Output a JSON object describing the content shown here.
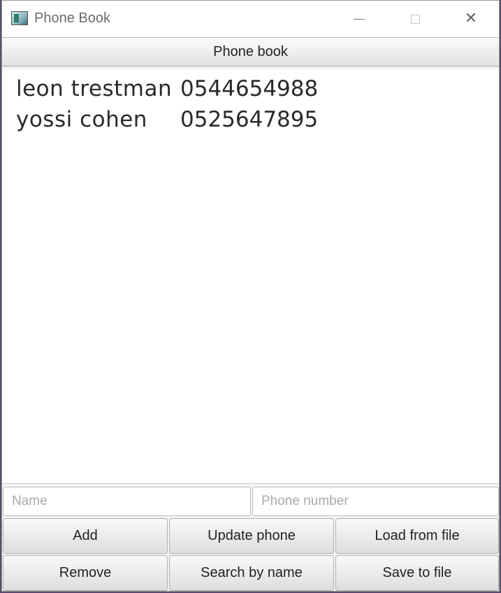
{
  "window": {
    "title": "Phone Book",
    "app_icon": "app-window-icon",
    "controls": {
      "minimize_icon": "minimize-icon",
      "maximize_icon": "maximize-icon",
      "close_icon": "close-icon",
      "close_glyph": "✕"
    }
  },
  "header": {
    "label": "Phone book"
  },
  "contacts": [
    {
      "name": "leon trestman",
      "phone": "0544654988"
    },
    {
      "name": "yossi cohen",
      "phone": "0525647895"
    }
  ],
  "inputs": {
    "name": {
      "value": "",
      "placeholder": "Name"
    },
    "phone": {
      "value": "",
      "placeholder": "Phone number"
    }
  },
  "buttons": {
    "add": "Add",
    "update_phone": "Update phone",
    "load_from_file": "Load from file",
    "remove": "Remove",
    "search_by_name": "Search by name",
    "save_to_file": "Save to file"
  }
}
